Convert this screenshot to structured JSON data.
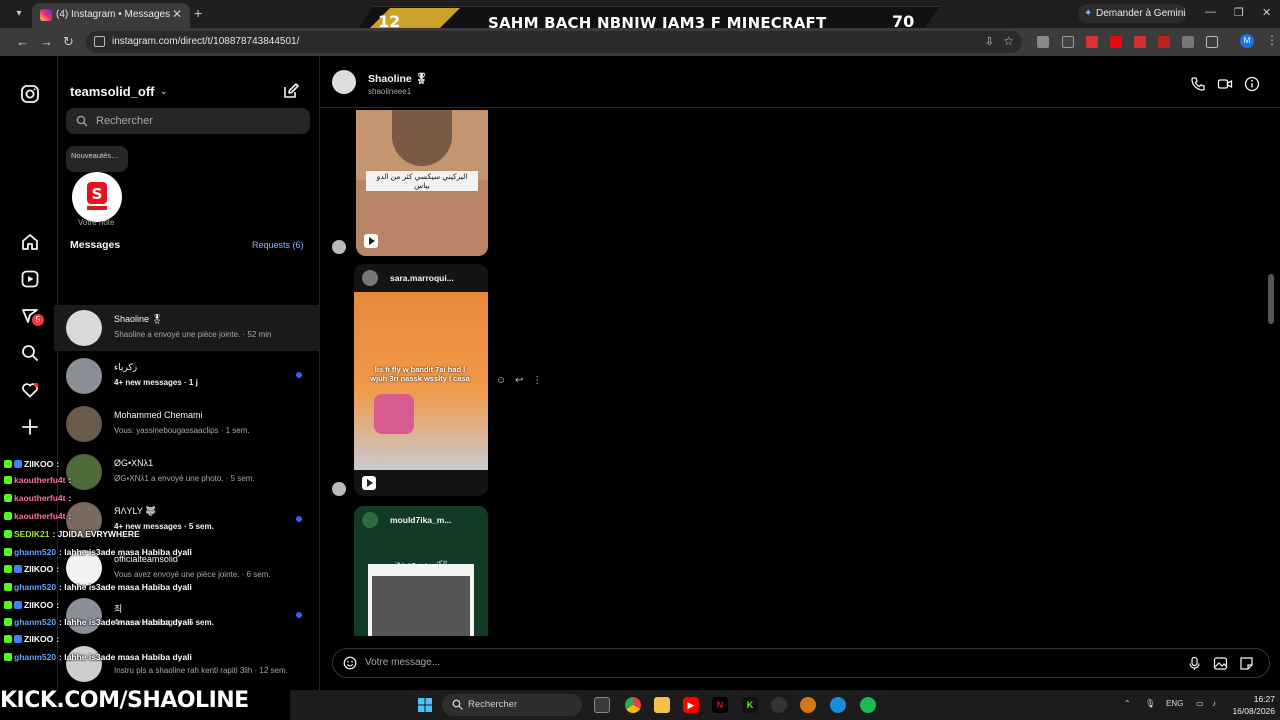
{
  "browser": {
    "tab_title": "(4) Instagram • Messages",
    "url": "instagram.com/direct/t/108878743844501/",
    "gemini_label": "Demander à Gemini",
    "profile_initial": "M"
  },
  "overlay": {
    "score_left": "12",
    "title": "SAHM BACH NBNIW JAM3 F MINECRAFT",
    "score_right": "70",
    "channel": "KICK.COM/SHAOLINE"
  },
  "rail": {
    "notifications_badge": "5"
  },
  "inbox": {
    "account": "teamsolid_off",
    "search_placeholder": "Rechercher",
    "note_text": "Nouveautés…",
    "note_label": "Votre note",
    "messages_heading": "Messages",
    "requests_label": "Requests (6)",
    "threads": [
      {
        "name": "Shaoline 🎖",
        "sub": "Shaoline a envoyé une pièce jointe. · 52 min",
        "unread": false,
        "active": true
      },
      {
        "name": "زكرياء",
        "sub": "4+ new messages · 1 j",
        "unread": true,
        "active": false
      },
      {
        "name": "Mohammed Chemami",
        "sub": "Vous: yassinebougassaaclips · 1 sem.",
        "unread": false,
        "active": false
      },
      {
        "name": "ØG•XNλ1",
        "sub": "ØG•XNλ1 a envoyé une photo. · 5 sem.",
        "unread": false,
        "active": false
      },
      {
        "name": "ЯΛYLY 🐺",
        "sub": "4+ new messages · 5 sem.",
        "unread": true,
        "active": false
      },
      {
        "name": "officialteamsolid",
        "sub": "Vous avez envoyé une pièce jointe. · 6 sem.",
        "unread": false,
        "active": false
      },
      {
        "name": "죄",
        "sub": "4+ new messages · 6 sem.",
        "unread": true,
        "active": false
      },
      {
        "name": "",
        "sub": "Instru pls a shaoline rah kenti rapiti 3lih · 12 sem.",
        "unread": false,
        "active": false
      }
    ]
  },
  "conversation": {
    "name": "Shaoline 🎖",
    "username": "shaolineee1",
    "reel1_caption": "البركيني سيكسي كثر من الدو بياس",
    "reel2_user": "sara.marroqui...",
    "reel2_caption": "lis fi fly w bandit 7ai had l wjuh 3ri nassk wsslty l casa",
    "reel3_user": "mould7ika_m...",
    "reel3_caption": "الكثير من حميدة:",
    "composer_placeholder": "Votre message..."
  },
  "chat": [
    {
      "user": "ZIIKOO",
      "msg": "",
      "color": "#ffffff"
    },
    {
      "user": "kaoutherfu4t",
      "msg": "",
      "color": "#ff6fae"
    },
    {
      "user": "kaoutherfu4t",
      "msg": "",
      "color": "#ff6fae"
    },
    {
      "user": "kaoutherfu4t",
      "msg": "",
      "color": "#ff6fae"
    },
    {
      "user": "SEDIK21",
      "msg": "JDIDA EVRYWHERE",
      "color": "#a3e635"
    },
    {
      "user": "ghanm520",
      "msg": "lahhe is3ade masa Habiba dyali",
      "color": "#60a5fa"
    },
    {
      "user": "ZIIKOO",
      "msg": "",
      "color": "#ffffff"
    },
    {
      "user": "ghanm520",
      "msg": "lahhe is3ade masa Habiba dyali",
      "color": "#60a5fa"
    },
    {
      "user": "ZIIKOO",
      "msg": "",
      "color": "#ffffff"
    },
    {
      "user": "ghanm520",
      "msg": "lahhe is3ade masa Habiba dyali",
      "color": "#60a5fa"
    },
    {
      "user": "ZIIKOO",
      "msg": "",
      "color": "#ffffff"
    },
    {
      "user": "ghanm520",
      "msg": "lahhe is3ade masa Habiba dyali",
      "color": "#60a5fa"
    }
  ],
  "taskbar": {
    "search_placeholder": "Rechercher",
    "language": "ENG",
    "time": "16:27",
    "date": "16/08/2026"
  }
}
